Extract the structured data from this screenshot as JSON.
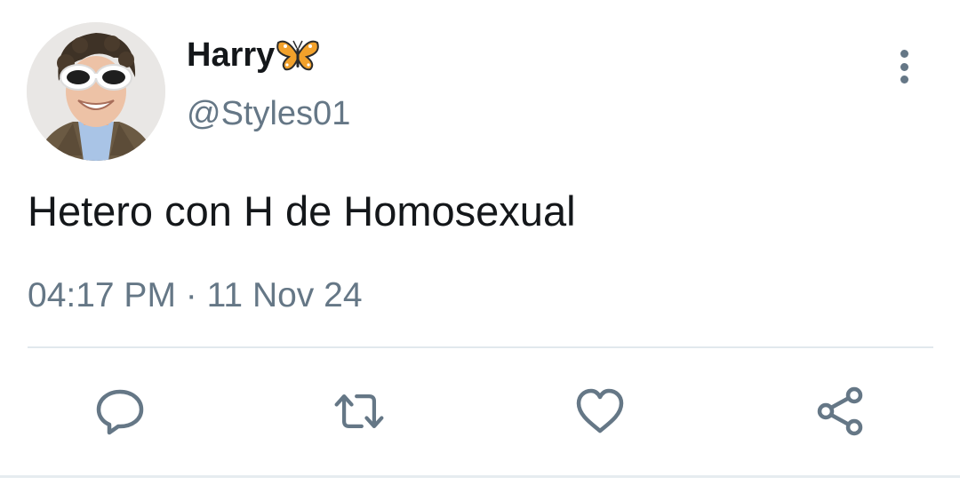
{
  "user": {
    "display_name": "Harry",
    "name_emoji": "butterfly-emoji",
    "handle": "@Styles01",
    "avatar": "profile-photo"
  },
  "tweet": {
    "text": "Hetero con H de Homosexual",
    "time": "04:17 PM",
    "separator": "·",
    "date": "11 Nov 24"
  },
  "actions": {
    "reply_icon": "reply-icon",
    "retweet_icon": "retweet-icon",
    "like_icon": "heart-icon",
    "share_icon": "share-icon"
  },
  "colors": {
    "text_primary": "#14171a",
    "text_secondary": "#657786",
    "divider": "#e1e8ed"
  }
}
